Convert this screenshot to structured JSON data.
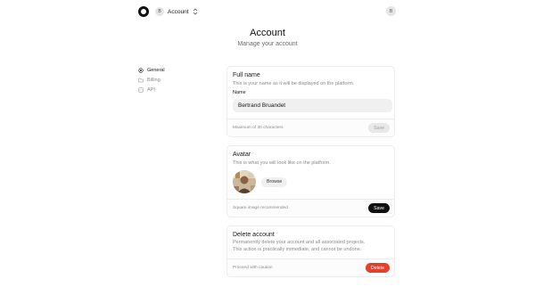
{
  "header": {
    "account_initial": "B",
    "account_label": "Account",
    "user_initial": "B"
  },
  "page": {
    "title": "Account",
    "subtitle": "Manage your account"
  },
  "sidebar": {
    "items": [
      {
        "label": "General",
        "icon": "gear-icon",
        "active": true
      },
      {
        "label": "Billing",
        "icon": "folder-icon",
        "active": false
      },
      {
        "label": "API",
        "icon": "code-icon",
        "active": false
      }
    ]
  },
  "full_name_card": {
    "title": "Full name",
    "description": "This is your name as it will be displayed on the platform.",
    "field_label": "Name",
    "value": "Bertrand Bruandet",
    "footer_note": "Maximum of 30 characters",
    "save_label": "Save"
  },
  "avatar_card": {
    "title": "Avatar",
    "description": "This is what you will look like on the platform.",
    "browse_label": "Browse",
    "footer_note": "Square image recommended",
    "save_label": "Save"
  },
  "delete_card": {
    "title": "Delete account",
    "description_line1": "Permanently delete your account and all associated projects.",
    "description_line2": "This action is practically immediate, and cannot be undone.",
    "footer_note": "Proceed with caution",
    "delete_label": "Delete"
  },
  "colors": {
    "accent_dark": "#111111",
    "danger": "#e5402d",
    "muted_text": "#8a8a8a"
  }
}
